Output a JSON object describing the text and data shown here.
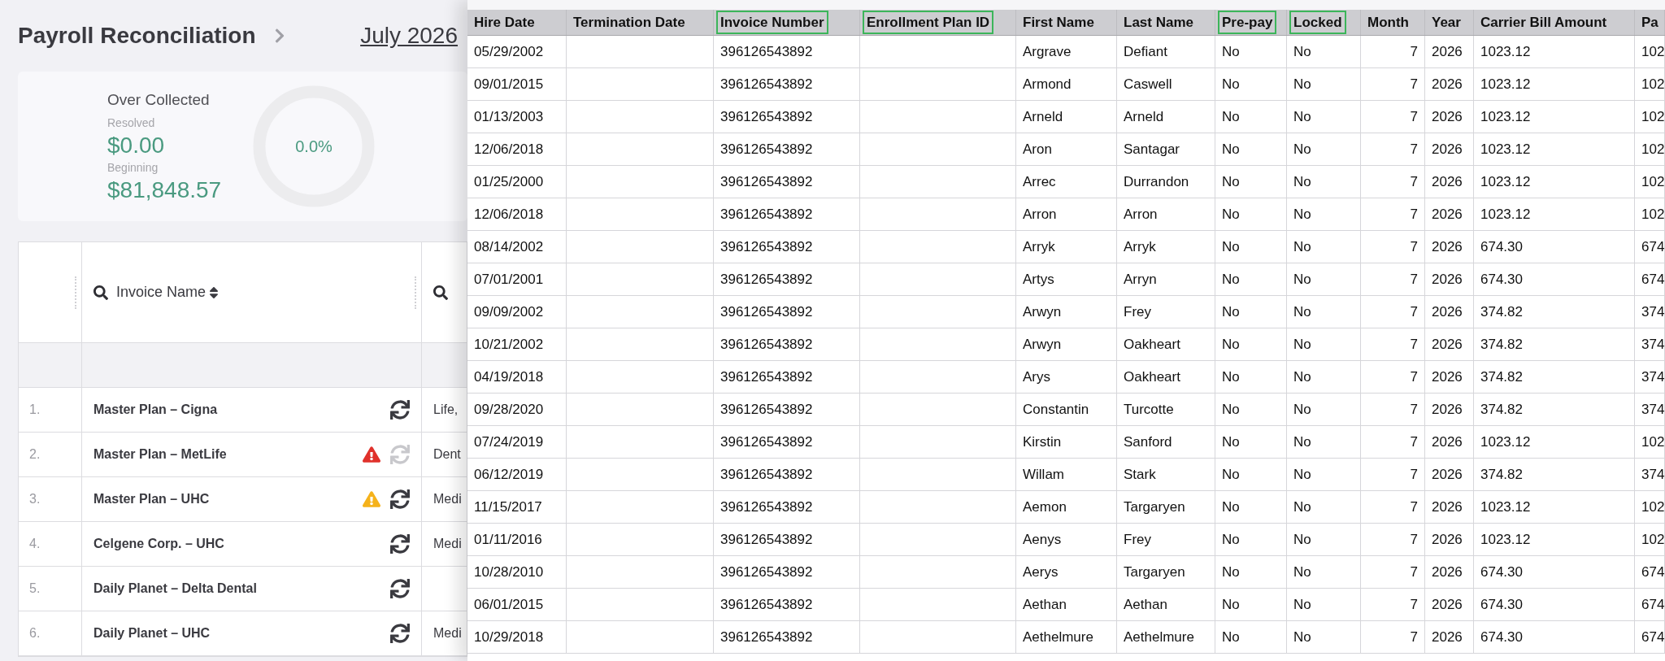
{
  "header": {
    "title": "Payroll Reconciliation",
    "period": "July 2026"
  },
  "summary": {
    "title": "Over Collected",
    "resolved_label": "Resolved",
    "resolved_value": "$0.00",
    "beginning_label": "Beginning",
    "beginning_value": "$81,848.57",
    "percent": "0.0%"
  },
  "invoices": {
    "column_header": "Invoice Name",
    "rows": [
      {
        "number": "1.",
        "name": "Master Plan – Cigna",
        "sync_disabled": false,
        "type": "Life,"
      },
      {
        "number": "2.",
        "name": "Master Plan – MetLife",
        "alert": {
          "color": "#e0312b"
        },
        "sync_disabled": true,
        "type": "Dent"
      },
      {
        "number": "3.",
        "name": "Master Plan – UHC",
        "alert": {
          "color": "#f5b21b"
        },
        "sync_disabled": false,
        "type": "Medi"
      },
      {
        "number": "4.",
        "name": "Celgene Corp. – UHC",
        "sync_disabled": false,
        "type": "Medi"
      },
      {
        "number": "5.",
        "name": "Daily Planet – Delta Dental",
        "sync_disabled": false,
        "type": null
      },
      {
        "number": "6.",
        "name": "Daily Planet – UHC",
        "sync_disabled": false,
        "type": "Medi"
      }
    ]
  },
  "sheet": {
    "columns": [
      {
        "label": "Hire Date",
        "highlighted": false,
        "kind": "text"
      },
      {
        "label": "Termination Date",
        "highlighted": false,
        "kind": "text"
      },
      {
        "label": "Invoice Number",
        "highlighted": true,
        "kind": "text"
      },
      {
        "label": "Enrollment Plan ID",
        "highlighted": true,
        "kind": "text"
      },
      {
        "label": "First Name",
        "highlighted": false,
        "kind": "text"
      },
      {
        "label": "Last Name",
        "highlighted": false,
        "kind": "text"
      },
      {
        "label": "Pre-pay",
        "highlighted": true,
        "kind": "text"
      },
      {
        "label": "Locked",
        "highlighted": true,
        "kind": "text"
      },
      {
        "label": "Month",
        "highlighted": false,
        "kind": "number"
      },
      {
        "label": "Year",
        "highlighted": false,
        "kind": "text"
      },
      {
        "label": "Carrier Bill Amount",
        "highlighted": false,
        "kind": "text"
      },
      {
        "label": "Pa",
        "highlighted": false,
        "kind": "text"
      }
    ],
    "rows": [
      [
        "05/29/2002",
        null,
        "396126543892",
        null,
        "Argrave",
        "Defiant",
        "No",
        "No",
        "7",
        "2026",
        "1023.12",
        "102"
      ],
      [
        "09/01/2015",
        null,
        "396126543892",
        null,
        "Armond",
        "Caswell",
        "No",
        "No",
        "7",
        "2026",
        "1023.12",
        "102"
      ],
      [
        "01/13/2003",
        null,
        "396126543892",
        null,
        "Arneld",
        "Arneld",
        "No",
        "No",
        "7",
        "2026",
        "1023.12",
        "102"
      ],
      [
        "12/06/2018",
        null,
        "396126543892",
        null,
        "Aron",
        "Santagar",
        "No",
        "No",
        "7",
        "2026",
        "1023.12",
        "102"
      ],
      [
        "01/25/2000",
        null,
        "396126543892",
        null,
        "Arrec",
        "Durrandon",
        "No",
        "No",
        "7",
        "2026",
        "1023.12",
        "102"
      ],
      [
        "12/06/2018",
        null,
        "396126543892",
        null,
        "Arron",
        "Arron",
        "No",
        "No",
        "7",
        "2026",
        "1023.12",
        "102"
      ],
      [
        "08/14/2002",
        null,
        "396126543892",
        null,
        "Arryk",
        "Arryk",
        "No",
        "No",
        "7",
        "2026",
        "674.30",
        "674"
      ],
      [
        "07/01/2001",
        null,
        "396126543892",
        null,
        "Artys",
        "Arryn",
        "No",
        "No",
        "7",
        "2026",
        "674.30",
        "674"
      ],
      [
        "09/09/2002",
        null,
        "396126543892",
        null,
        "Arwyn",
        "Frey",
        "No",
        "No",
        "7",
        "2026",
        "374.82",
        "374"
      ],
      [
        "10/21/2002",
        null,
        "396126543892",
        null,
        "Arwyn",
        "Oakheart",
        "No",
        "No",
        "7",
        "2026",
        "374.82",
        "374"
      ],
      [
        "04/19/2018",
        null,
        "396126543892",
        null,
        "Arys",
        "Oakheart",
        "No",
        "No",
        "7",
        "2026",
        "374.82",
        "374"
      ],
      [
        "09/28/2020",
        null,
        "396126543892",
        null,
        "Constantin",
        "Turcotte",
        "No",
        "No",
        "7",
        "2026",
        "374.82",
        "374"
      ],
      [
        "07/24/2019",
        null,
        "396126543892",
        null,
        "Kirstin",
        "Sanford",
        "No",
        "No",
        "7",
        "2026",
        "1023.12",
        "102"
      ],
      [
        "06/12/2019",
        null,
        "396126543892",
        null,
        "Willam",
        "Stark",
        "No",
        "No",
        "7",
        "2026",
        "374.82",
        "374"
      ],
      [
        "11/15/2017",
        null,
        "396126543892",
        null,
        "Aemon",
        "Targaryen",
        "No",
        "No",
        "7",
        "2026",
        "1023.12",
        "102"
      ],
      [
        "01/11/2016",
        null,
        "396126543892",
        null,
        "Aenys",
        "Frey",
        "No",
        "No",
        "7",
        "2026",
        "1023.12",
        "102"
      ],
      [
        "10/28/2010",
        null,
        "396126543892",
        null,
        "Aerys",
        "Targaryen",
        "No",
        "No",
        "7",
        "2026",
        "674.30",
        "674"
      ],
      [
        "06/01/2015",
        null,
        "396126543892",
        null,
        "Aethan",
        "Aethan",
        "No",
        "No",
        "7",
        "2026",
        "674.30",
        "674"
      ],
      [
        "10/29/2018",
        null,
        "396126543892",
        null,
        "Aethelmure",
        "Aethelmure",
        "No",
        "No",
        "7",
        "2026",
        "674.30",
        "674"
      ]
    ]
  }
}
